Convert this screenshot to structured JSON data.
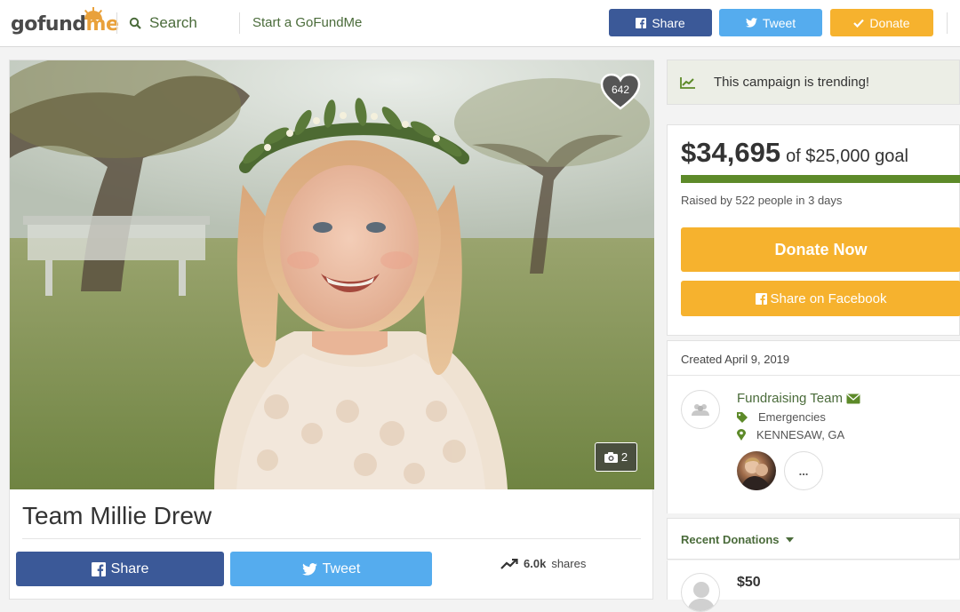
{
  "header": {
    "logo": {
      "part1": "gofund",
      "part2": "me"
    },
    "search_label": "Search",
    "start_label": "Start a GoFundMe",
    "share_label": "Share",
    "tweet_label": "Tweet",
    "donate_label": "Donate"
  },
  "campaign": {
    "title": "Team Millie Drew",
    "heart_count": "642",
    "photo_count": "2",
    "share_label": "Share",
    "tweet_label": "Tweet",
    "shares_count": "6.0k",
    "shares_label": "shares"
  },
  "sidebar": {
    "trending_text": "This campaign is trending!",
    "raised_amount": "$34,695",
    "goal_text": "of $25,000 goal",
    "progress_fraction": 1.0,
    "raised_by": "Raised by 522 people in 3 days",
    "donate_now_label": "Donate Now",
    "share_facebook_label": "Share on Facebook",
    "created": "Created April 9, 2019",
    "team_name": "Fundraising Team",
    "category": "Emergencies",
    "location": "KENNESAW, GA",
    "more_label": "...",
    "recent_donations_label": "Recent Donations",
    "donations": [
      {
        "amount": "$50"
      }
    ]
  },
  "colors": {
    "facebook": "#3b5998",
    "twitter": "#55acee",
    "donate": "#f6b22e",
    "brand_green": "#4a6b3a",
    "progress": "#5d8a29"
  }
}
